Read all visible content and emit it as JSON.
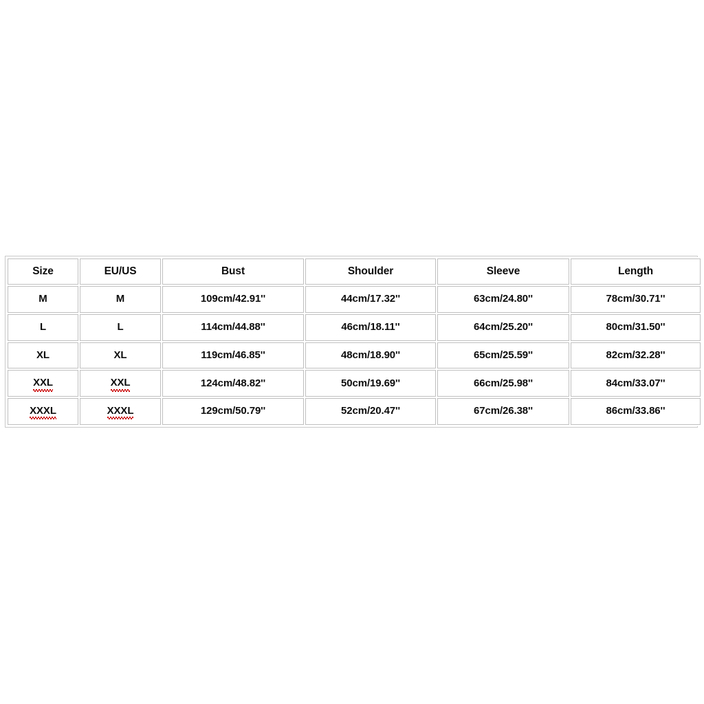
{
  "page": {
    "background_color": "#ffffff",
    "content_type": "apparel-size-chart"
  },
  "table": {
    "border_color": "#bfbfbf",
    "outer_border_color": "#c9c9c9",
    "text_color": "#0d0d0d",
    "spellcheck_underline_color": "#cc1111",
    "headers": [
      "Size",
      "EU/US",
      "Bust",
      "Shoulder",
      "Sleeve",
      "Length"
    ],
    "rows": [
      {
        "size": "M",
        "eu_us": "M",
        "bust": "109cm/42.91''",
        "shoulder": "44cm/17.32''",
        "sleeve": "63cm/24.80''",
        "length": "78cm/30.71''",
        "misspelled": false
      },
      {
        "size": "L",
        "eu_us": "L",
        "bust": "114cm/44.88''",
        "shoulder": "46cm/18.11''",
        "sleeve": "64cm/25.20''",
        "length": "80cm/31.50''",
        "misspelled": false
      },
      {
        "size": "XL",
        "eu_us": "XL",
        "bust": "119cm/46.85''",
        "shoulder": "48cm/18.90''",
        "sleeve": "65cm/25.59''",
        "length": "82cm/32.28''",
        "misspelled": false
      },
      {
        "size": "XXL",
        "eu_us": "XXL",
        "bust": "124cm/48.82''",
        "shoulder": "50cm/19.69''",
        "sleeve": "66cm/25.98''",
        "length": "84cm/33.07''",
        "misspelled": true
      },
      {
        "size": "XXXL",
        "eu_us": "XXXL",
        "bust": "129cm/50.79''",
        "shoulder": "52cm/20.47''",
        "sleeve": "67cm/26.38''",
        "length": "86cm/33.86''",
        "misspelled": true
      }
    ]
  }
}
